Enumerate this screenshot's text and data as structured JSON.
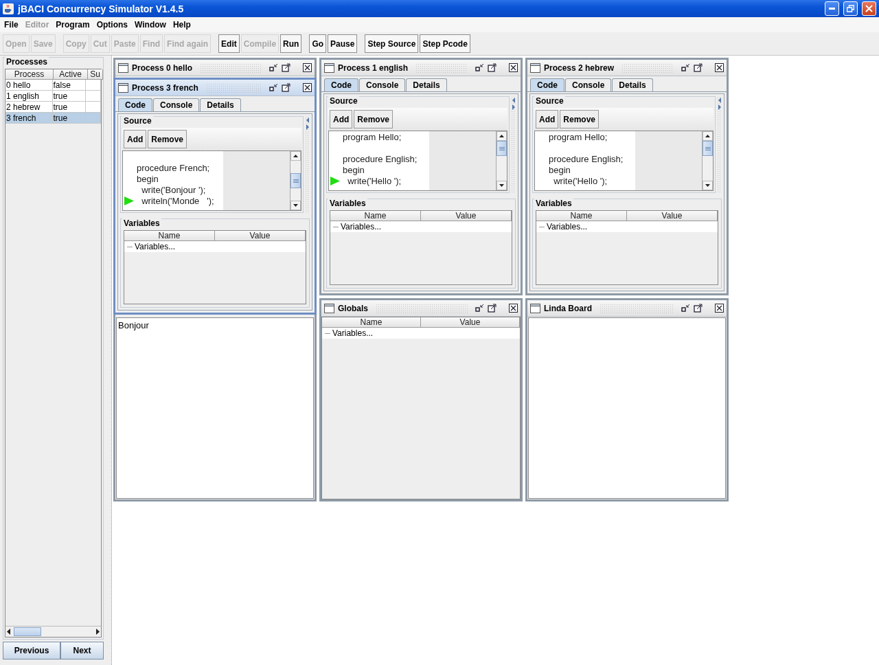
{
  "window": {
    "title": "jBACI Concurrency Simulator V1.4.5"
  },
  "menu": [
    {
      "label": "File",
      "disabled": false
    },
    {
      "label": "Editor",
      "disabled": true
    },
    {
      "label": "Program",
      "disabled": false
    },
    {
      "label": "Options",
      "disabled": false
    },
    {
      "label": "Window",
      "disabled": false
    },
    {
      "label": "Help",
      "disabled": false
    }
  ],
  "toolbar": [
    [
      {
        "label": "Open",
        "disabled": true
      },
      {
        "label": "Save",
        "disabled": true
      }
    ],
    [
      {
        "label": "Copy",
        "disabled": true
      },
      {
        "label": "Cut",
        "disabled": true
      },
      {
        "label": "Paste",
        "disabled": true
      },
      {
        "label": "Find",
        "disabled": true
      },
      {
        "label": "Find again",
        "disabled": true
      }
    ],
    [
      {
        "label": "Edit",
        "disabled": false
      },
      {
        "label": "Compile",
        "disabled": true
      },
      {
        "label": "Run",
        "disabled": false
      }
    ],
    [
      {
        "label": "Go",
        "disabled": false
      },
      {
        "label": "Pause",
        "disabled": false
      }
    ],
    [
      {
        "label": "Step Source",
        "disabled": false
      },
      {
        "label": "Step Pcode",
        "disabled": false
      }
    ]
  ],
  "processes": {
    "title": "Processes",
    "columns": [
      "Process",
      "Active",
      "Su"
    ],
    "rows": [
      {
        "process": "0 hello",
        "active": "false",
        "selected": false
      },
      {
        "process": "1 english",
        "active": "true",
        "selected": false
      },
      {
        "process": "2 hebrew",
        "active": "true",
        "selected": false
      },
      {
        "process": "3 french",
        "active": "true",
        "selected": true
      }
    ],
    "buttons": [
      "Previous",
      "Next"
    ]
  },
  "frames": [
    {
      "kind": "console",
      "title": "Process 0 hello",
      "active": false,
      "text": "Bonjour"
    },
    {
      "kind": "process",
      "title": "Process 3 french",
      "active": true,
      "tabs": [
        {
          "label": "Code",
          "selected": true
        },
        {
          "label": "Console",
          "selected": false
        },
        {
          "label": "Details",
          "selected": false
        }
      ],
      "source": {
        "title": "Source",
        "buttons": [
          "Add",
          "Remove"
        ],
        "lines": [
          {
            "kind": "blank"
          },
          {
            "kind": "code",
            "text": "procedure French;",
            "current": false
          },
          {
            "kind": "code",
            "text": "begin",
            "current": false
          },
          {
            "kind": "code",
            "text": "  write('Bonjour ');",
            "current": false
          },
          {
            "kind": "code",
            "text": "  writeln('Monde   ');",
            "current": true
          }
        ]
      },
      "variables": {
        "title": "Variables",
        "columns": [
          "Name",
          "Value"
        ],
        "rows": [
          "Variables..."
        ]
      }
    },
    {
      "kind": "process",
      "title": "Process 1 english",
      "active": false,
      "tabs": [
        {
          "label": "Code",
          "selected": true
        },
        {
          "label": "Console",
          "selected": false
        },
        {
          "label": "Details",
          "selected": false
        }
      ],
      "source": {
        "title": "Source",
        "buttons": [
          "Add",
          "Remove"
        ],
        "lines": [
          {
            "kind": "code",
            "text": "program Hello;",
            "current": false
          },
          {
            "kind": "blank"
          },
          {
            "kind": "code",
            "text": "procedure English;",
            "current": false
          },
          {
            "kind": "code",
            "text": "begin",
            "current": false
          },
          {
            "kind": "code",
            "text": "  write('Hello ');",
            "current": true
          }
        ]
      },
      "variables": {
        "title": "Variables",
        "columns": [
          "Name",
          "Value"
        ],
        "rows": [
          "Variables..."
        ]
      }
    },
    {
      "kind": "process",
      "title": "Process 2 hebrew",
      "active": false,
      "tabs": [
        {
          "label": "Code",
          "selected": true
        },
        {
          "label": "Console",
          "selected": false
        },
        {
          "label": "Details",
          "selected": false
        }
      ],
      "source": {
        "title": "Source",
        "buttons": [
          "Add",
          "Remove"
        ],
        "lines": [
          {
            "kind": "code",
            "text": "program Hello;",
            "current": false
          },
          {
            "kind": "blank"
          },
          {
            "kind": "code",
            "text": "procedure English;",
            "current": false
          },
          {
            "kind": "code",
            "text": "begin",
            "current": false
          },
          {
            "kind": "code",
            "text": "  write('Hello ');",
            "current": false
          }
        ]
      },
      "variables": {
        "title": "Variables",
        "columns": [
          "Name",
          "Value"
        ],
        "rows": [
          "Variables..."
        ]
      }
    },
    {
      "kind": "variables",
      "title": "Globals",
      "active": false,
      "columns": [
        "Name",
        "Value"
      ],
      "rows": [
        "Variables..."
      ]
    },
    {
      "kind": "board",
      "title": "Linda Board",
      "active": false
    }
  ]
}
